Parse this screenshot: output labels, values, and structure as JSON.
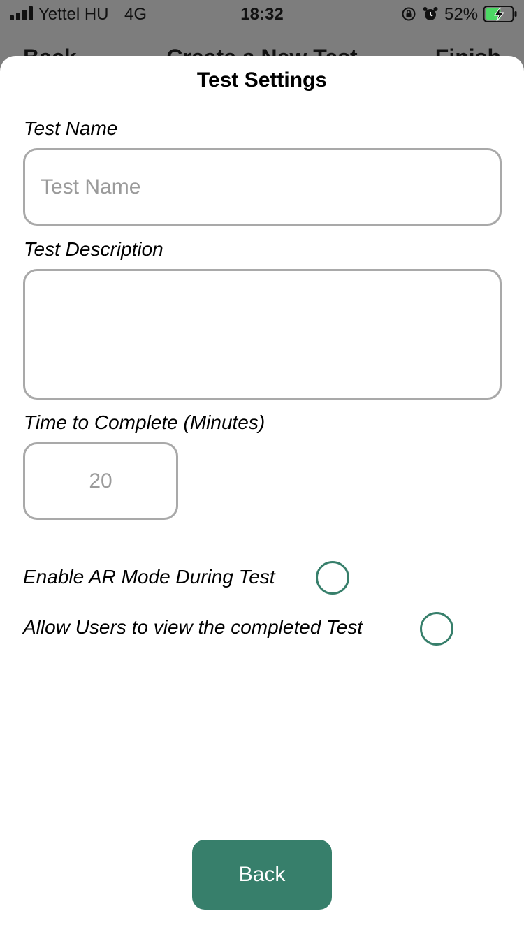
{
  "status_bar": {
    "carrier": "Yettel HU",
    "network": "4G",
    "time": "18:32",
    "battery_percent": "52%",
    "icons": [
      "signal-icon",
      "orientation-lock-icon",
      "alarm-icon",
      "battery-charging-icon"
    ]
  },
  "underlying_nav": {
    "back": "Back",
    "title": "Create a New Test",
    "finish": "Finish"
  },
  "sheet": {
    "title": "Test Settings",
    "test_name": {
      "label": "Test Name",
      "placeholder": "Test Name",
      "value": ""
    },
    "test_description": {
      "label": "Test Description",
      "value": ""
    },
    "time_to_complete": {
      "label": "Time to Complete (Minutes)",
      "placeholder": "20",
      "value": ""
    },
    "toggles": [
      {
        "label": "Enable AR Mode During Test",
        "selected": false
      },
      {
        "label": "Allow Users to view the completed Test",
        "selected": false
      }
    ],
    "back_button": "Back"
  },
  "colors": {
    "accent": "#377f6b",
    "input_border": "#a9a9a9",
    "backdrop": "#7d7d7d"
  }
}
